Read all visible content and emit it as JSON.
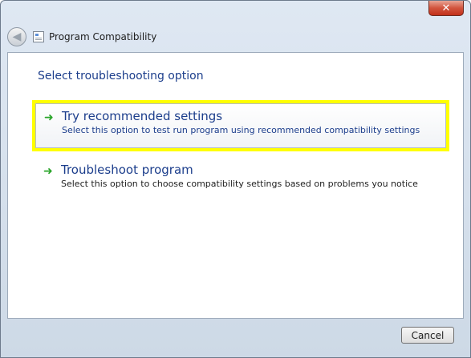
{
  "window": {
    "close_glyph": "x"
  },
  "header": {
    "title": "Program Compatibility",
    "back_icon": "back-arrow-icon",
    "app_icon": "program-compatibility-icon"
  },
  "main": {
    "heading": "Select troubleshooting option",
    "options": [
      {
        "title": "Try recommended settings",
        "description": "Select this option to test run program using recommended compatibility settings",
        "icon": "green-arrow-icon",
        "selected": true
      },
      {
        "title": "Troubleshoot program",
        "description": "Select this option to choose compatibility settings based on problems you notice",
        "icon": "green-arrow-icon",
        "selected": false
      }
    ]
  },
  "footer": {
    "cancel_label": "Cancel"
  },
  "colors": {
    "highlight": "#ffff00",
    "link_blue": "#1c3e8c",
    "arrow_green": "#2aa52a",
    "close_red": "#c1301a"
  }
}
